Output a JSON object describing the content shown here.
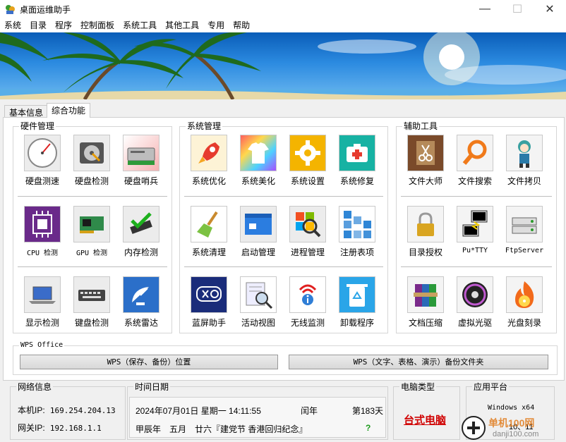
{
  "window": {
    "title": "桌面运维助手",
    "minimize": "—",
    "maximize": "☐",
    "close": "✕"
  },
  "menu": [
    "系统",
    "目录",
    "程序",
    "控制面板",
    "系统工具",
    "其他工具",
    "专用",
    "帮助"
  ],
  "tabs": [
    "基本信息",
    "综合功能"
  ],
  "groups": {
    "hardware": {
      "title": "硬件管理",
      "items": [
        "硬盘测速",
        "硬盘检测",
        "硬盘哨兵",
        "CPU 检测",
        "GPU 检测",
        "内存检测",
        "显示检测",
        "键盘检测",
        "系统雷达"
      ]
    },
    "system": {
      "title": "系统管理",
      "items": [
        "系统优化",
        "系统美化",
        "系统设置",
        "系统修复",
        "系统清理",
        "启动管理",
        "进程管理",
        "注册表项",
        "蓝屏助手",
        "活动视图",
        "无线监测",
        "卸载程序"
      ]
    },
    "aux": {
      "title": "辅助工具",
      "items": [
        "文件大师",
        "文件搜索",
        "文件拷贝",
        "目录授权",
        "Pu*TTY",
        "FtpServer",
        "文档压缩",
        "虚拟光驱",
        "光盘刻录"
      ]
    },
    "wps": {
      "title": "WPS Office",
      "btn1": "WPS（保存、备份）位置",
      "btn2": "WPS（文字、表格、演示）备份文件夹"
    }
  },
  "status": {
    "network": {
      "title": "网络信息",
      "ip_label": "本机IP:",
      "ip": "169.254.204.13",
      "gw_label": "网关IP:",
      "gw": "192.168.1.1"
    },
    "datetime": {
      "title": "时间日期",
      "line1": "2024年07月01日 星期一 14:11:55",
      "leap": "闰年",
      "day": "第183天",
      "line2": "甲辰年　五月　廿六『建党节 香港回归纪念』",
      "q": "?"
    },
    "pctype": {
      "title": "电脑类型",
      "value": "台式电脑"
    },
    "platform": {
      "title": "应用平台",
      "os": "Windows x64",
      "ver": "10、11"
    }
  },
  "watermark": {
    "text": "单机100网",
    "url": "danji100.com"
  },
  "colors": {
    "pctype": "#d00000",
    "q": "#1a9a1a"
  }
}
